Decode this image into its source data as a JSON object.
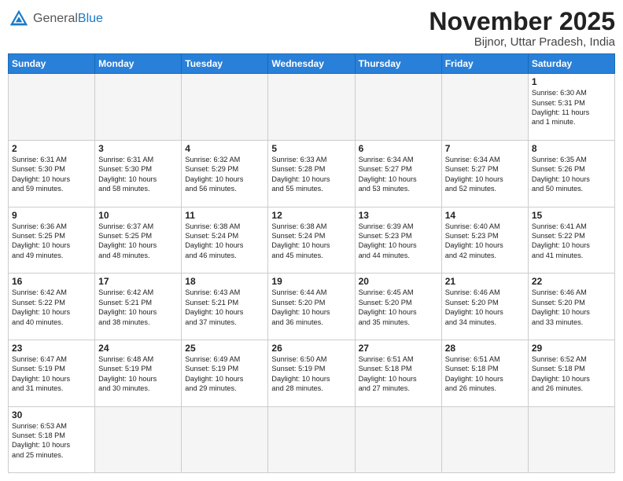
{
  "header": {
    "logo_general": "General",
    "logo_blue": "Blue",
    "month_title": "November 2025",
    "location": "Bijnor, Uttar Pradesh, India"
  },
  "days_of_week": [
    "Sunday",
    "Monday",
    "Tuesday",
    "Wednesday",
    "Thursday",
    "Friday",
    "Saturday"
  ],
  "weeks": [
    [
      {
        "day": "",
        "info": ""
      },
      {
        "day": "",
        "info": ""
      },
      {
        "day": "",
        "info": ""
      },
      {
        "day": "",
        "info": ""
      },
      {
        "day": "",
        "info": ""
      },
      {
        "day": "",
        "info": ""
      },
      {
        "day": "1",
        "info": "Sunrise: 6:30 AM\nSunset: 5:31 PM\nDaylight: 11 hours\nand 1 minute."
      }
    ],
    [
      {
        "day": "2",
        "info": "Sunrise: 6:31 AM\nSunset: 5:30 PM\nDaylight: 10 hours\nand 59 minutes."
      },
      {
        "day": "3",
        "info": "Sunrise: 6:31 AM\nSunset: 5:30 PM\nDaylight: 10 hours\nand 58 minutes."
      },
      {
        "day": "4",
        "info": "Sunrise: 6:32 AM\nSunset: 5:29 PM\nDaylight: 10 hours\nand 56 minutes."
      },
      {
        "day": "5",
        "info": "Sunrise: 6:33 AM\nSunset: 5:28 PM\nDaylight: 10 hours\nand 55 minutes."
      },
      {
        "day": "6",
        "info": "Sunrise: 6:34 AM\nSunset: 5:27 PM\nDaylight: 10 hours\nand 53 minutes."
      },
      {
        "day": "7",
        "info": "Sunrise: 6:34 AM\nSunset: 5:27 PM\nDaylight: 10 hours\nand 52 minutes."
      },
      {
        "day": "8",
        "info": "Sunrise: 6:35 AM\nSunset: 5:26 PM\nDaylight: 10 hours\nand 50 minutes."
      }
    ],
    [
      {
        "day": "9",
        "info": "Sunrise: 6:36 AM\nSunset: 5:25 PM\nDaylight: 10 hours\nand 49 minutes."
      },
      {
        "day": "10",
        "info": "Sunrise: 6:37 AM\nSunset: 5:25 PM\nDaylight: 10 hours\nand 48 minutes."
      },
      {
        "day": "11",
        "info": "Sunrise: 6:38 AM\nSunset: 5:24 PM\nDaylight: 10 hours\nand 46 minutes."
      },
      {
        "day": "12",
        "info": "Sunrise: 6:38 AM\nSunset: 5:24 PM\nDaylight: 10 hours\nand 45 minutes."
      },
      {
        "day": "13",
        "info": "Sunrise: 6:39 AM\nSunset: 5:23 PM\nDaylight: 10 hours\nand 44 minutes."
      },
      {
        "day": "14",
        "info": "Sunrise: 6:40 AM\nSunset: 5:23 PM\nDaylight: 10 hours\nand 42 minutes."
      },
      {
        "day": "15",
        "info": "Sunrise: 6:41 AM\nSunset: 5:22 PM\nDaylight: 10 hours\nand 41 minutes."
      }
    ],
    [
      {
        "day": "16",
        "info": "Sunrise: 6:42 AM\nSunset: 5:22 PM\nDaylight: 10 hours\nand 40 minutes."
      },
      {
        "day": "17",
        "info": "Sunrise: 6:42 AM\nSunset: 5:21 PM\nDaylight: 10 hours\nand 38 minutes."
      },
      {
        "day": "18",
        "info": "Sunrise: 6:43 AM\nSunset: 5:21 PM\nDaylight: 10 hours\nand 37 minutes."
      },
      {
        "day": "19",
        "info": "Sunrise: 6:44 AM\nSunset: 5:20 PM\nDaylight: 10 hours\nand 36 minutes."
      },
      {
        "day": "20",
        "info": "Sunrise: 6:45 AM\nSunset: 5:20 PM\nDaylight: 10 hours\nand 35 minutes."
      },
      {
        "day": "21",
        "info": "Sunrise: 6:46 AM\nSunset: 5:20 PM\nDaylight: 10 hours\nand 34 minutes."
      },
      {
        "day": "22",
        "info": "Sunrise: 6:46 AM\nSunset: 5:20 PM\nDaylight: 10 hours\nand 33 minutes."
      }
    ],
    [
      {
        "day": "23",
        "info": "Sunrise: 6:47 AM\nSunset: 5:19 PM\nDaylight: 10 hours\nand 31 minutes."
      },
      {
        "day": "24",
        "info": "Sunrise: 6:48 AM\nSunset: 5:19 PM\nDaylight: 10 hours\nand 30 minutes."
      },
      {
        "day": "25",
        "info": "Sunrise: 6:49 AM\nSunset: 5:19 PM\nDaylight: 10 hours\nand 29 minutes."
      },
      {
        "day": "26",
        "info": "Sunrise: 6:50 AM\nSunset: 5:19 PM\nDaylight: 10 hours\nand 28 minutes."
      },
      {
        "day": "27",
        "info": "Sunrise: 6:51 AM\nSunset: 5:18 PM\nDaylight: 10 hours\nand 27 minutes."
      },
      {
        "day": "28",
        "info": "Sunrise: 6:51 AM\nSunset: 5:18 PM\nDaylight: 10 hours\nand 26 minutes."
      },
      {
        "day": "29",
        "info": "Sunrise: 6:52 AM\nSunset: 5:18 PM\nDaylight: 10 hours\nand 26 minutes."
      }
    ],
    [
      {
        "day": "30",
        "info": "Sunrise: 6:53 AM\nSunset: 5:18 PM\nDaylight: 10 hours\nand 25 minutes."
      },
      {
        "day": "",
        "info": ""
      },
      {
        "day": "",
        "info": ""
      },
      {
        "day": "",
        "info": ""
      },
      {
        "day": "",
        "info": ""
      },
      {
        "day": "",
        "info": ""
      },
      {
        "day": "",
        "info": ""
      }
    ]
  ]
}
